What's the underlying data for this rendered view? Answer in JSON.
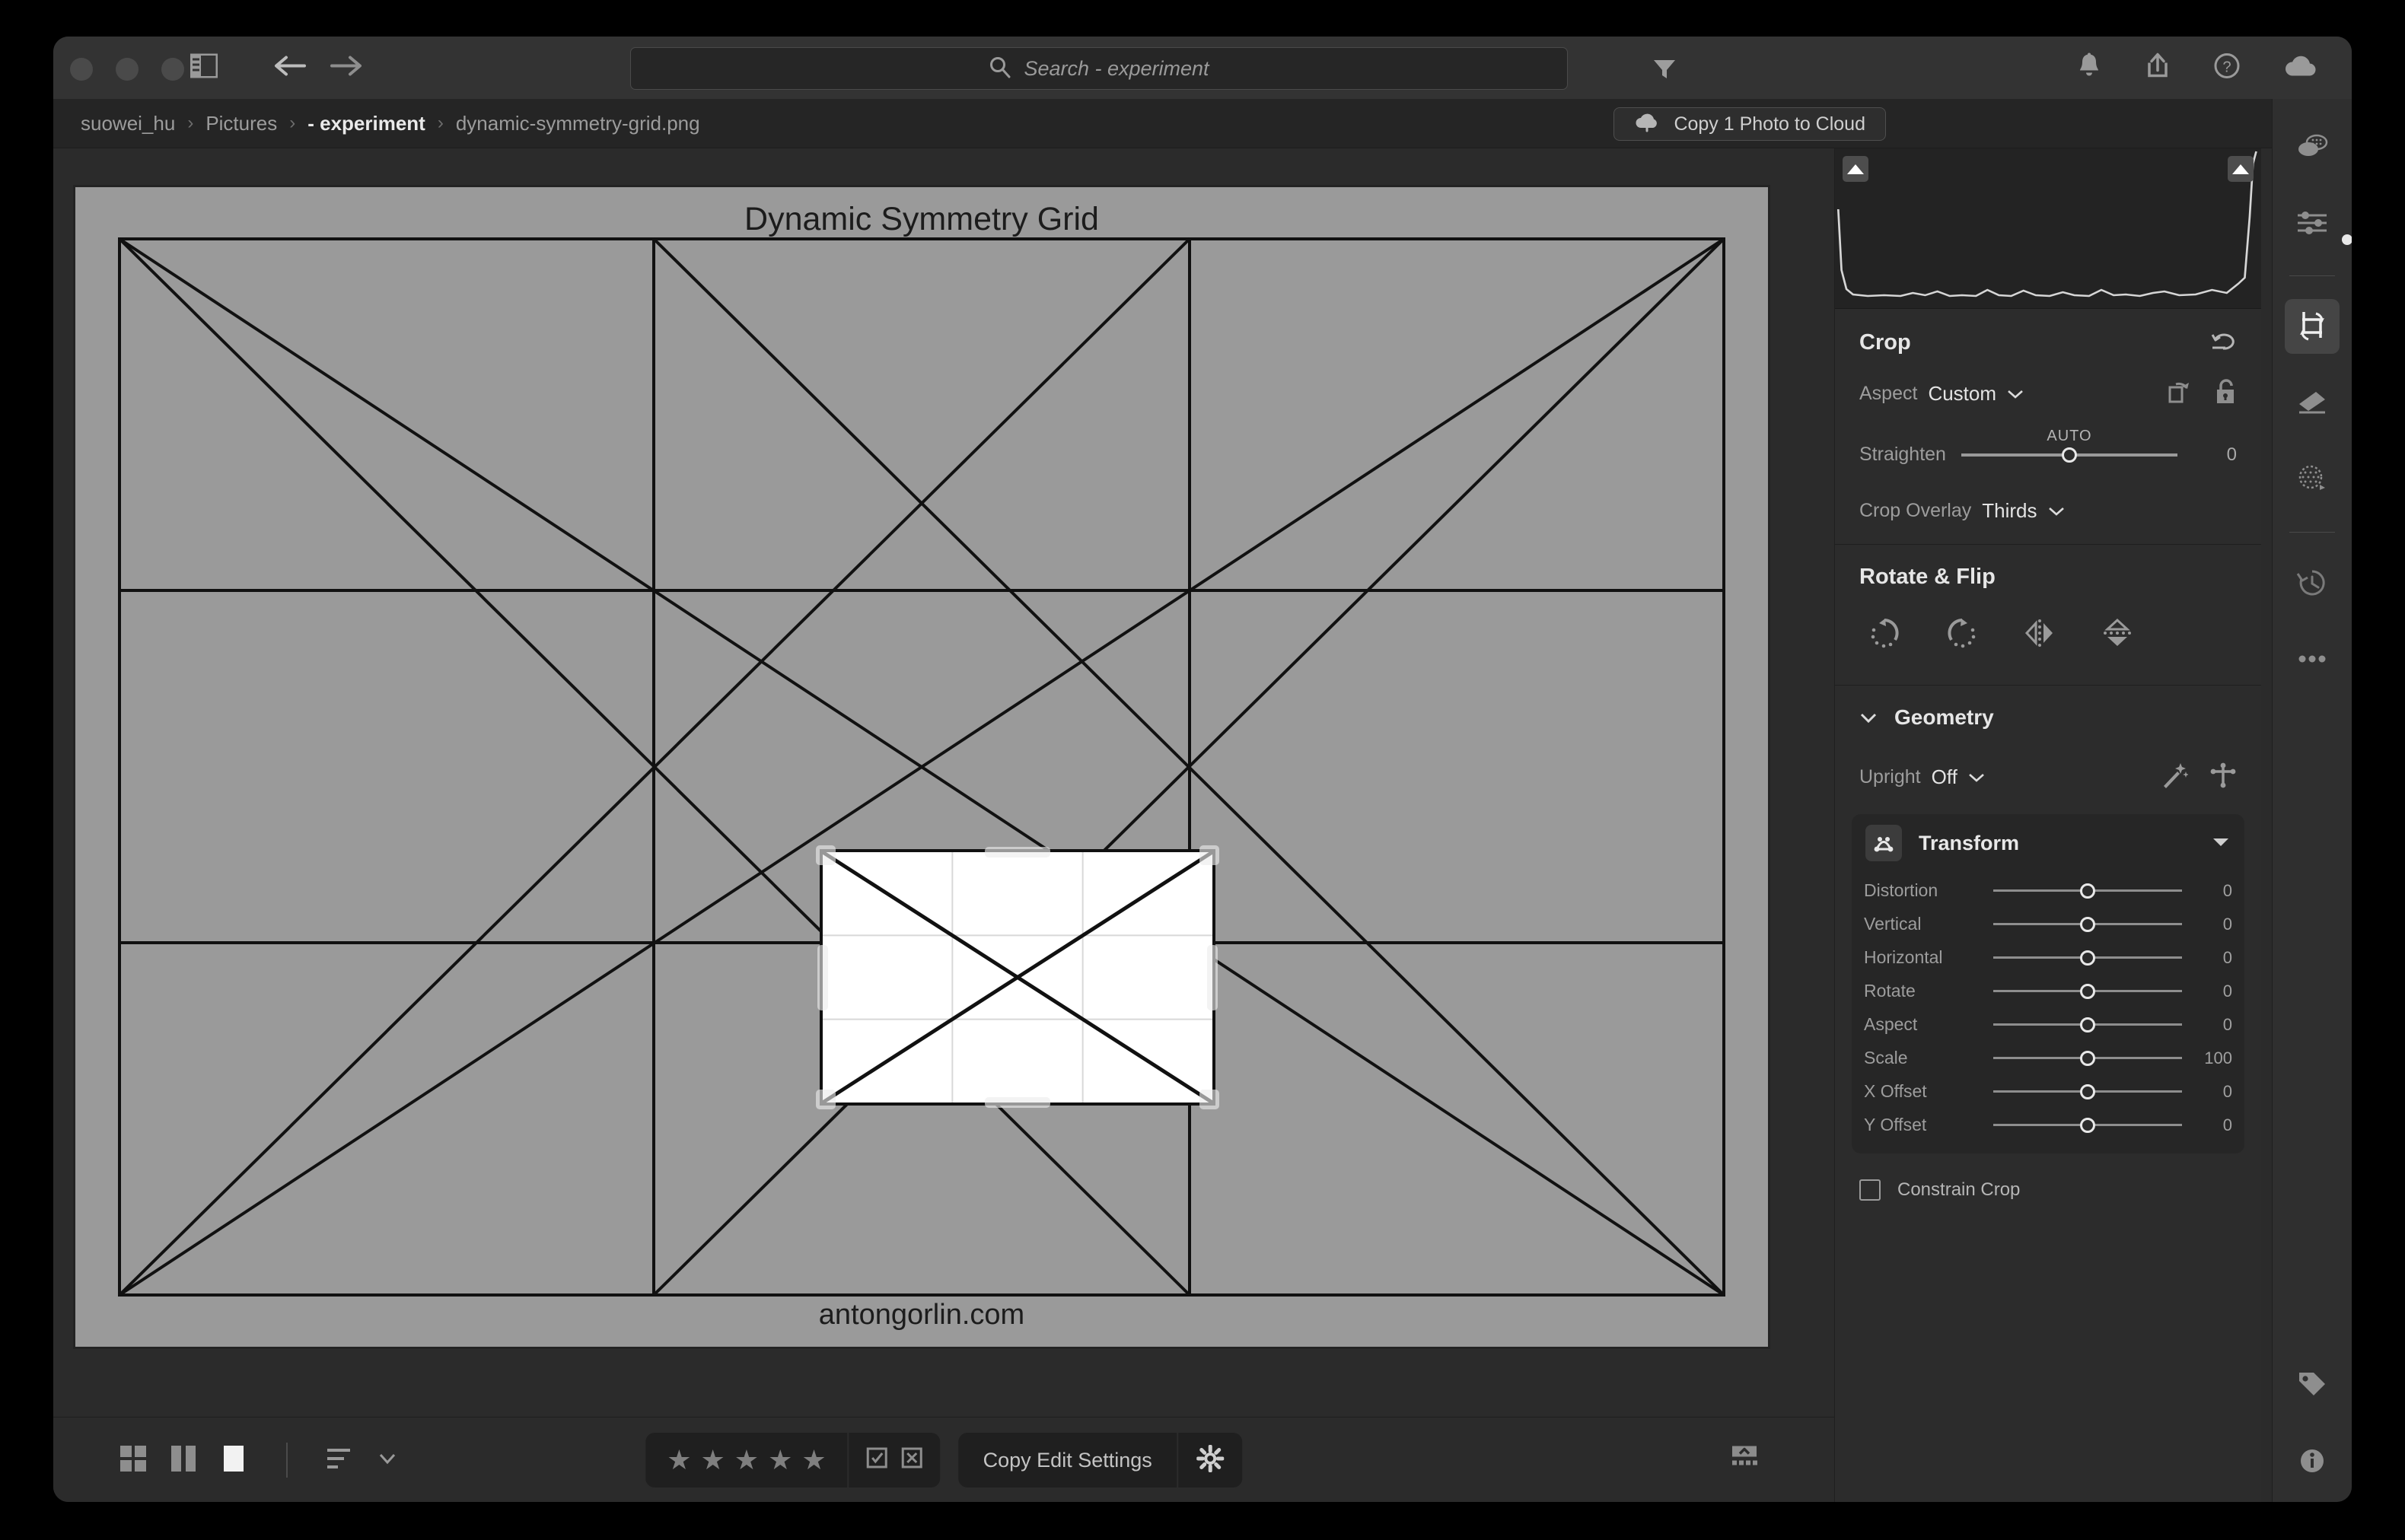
{
  "window": {
    "traffic_lights": [
      "close",
      "minimize",
      "maximize"
    ],
    "panel_toggle_icon": "sidebar-toggle-icon",
    "back_icon": "arrow-left-icon",
    "forward_icon": "arrow-right-icon",
    "notification_icon": "bell-icon",
    "share_icon": "share-icon",
    "help_icon": "help-circle-icon",
    "cloud_icon": "cloud-icon"
  },
  "search": {
    "placeholder": "Search - experiment",
    "icon": "search-icon",
    "filter_icon": "filter-icon"
  },
  "breadcrumb": {
    "items": [
      {
        "label": "suowei_hu",
        "active": false
      },
      {
        "label": "Pictures",
        "active": false
      },
      {
        "label": "- experiment",
        "active": true
      },
      {
        "label": "dynamic-symmetry-grid.png",
        "active": false
      }
    ],
    "separator": "›"
  },
  "cloud_button": {
    "label": "Copy 1 Photo to Cloud",
    "icon": "cloud-upload-icon"
  },
  "photo": {
    "title": "Dynamic Symmetry Grid",
    "footer": "antongorlin.com",
    "background_color": "#9a9a9a",
    "line_color": "#111111",
    "crop_overlay": "Thirds"
  },
  "histogram": {
    "clip_left_icon": "triangle-up-icon",
    "clip_right_icon": "triangle-up-icon"
  },
  "crop": {
    "title": "Crop",
    "reset_icon": "undo-icon",
    "aspect_label": "Aspect",
    "aspect_value": "Custom",
    "rotate_lock_icon": "rotate-aspect-icon",
    "lock_icon": "lock-open-icon",
    "straighten_label": "Straighten",
    "straighten_auto": "AUTO",
    "straighten_value": "0",
    "overlay_label": "Crop Overlay",
    "overlay_value": "Thirds"
  },
  "rotate_flip": {
    "title": "Rotate & Flip",
    "icons": [
      "rotate-clockwise-icon",
      "rotate-counterclockwise-icon",
      "flip-horizontal-icon",
      "flip-vertical-icon"
    ]
  },
  "geometry": {
    "title": "Geometry",
    "chevron_icon": "chevron-down-icon",
    "upright_label": "Upright",
    "upright_value": "Off",
    "auto_icon": "magic-wand-icon",
    "guided_icon": "guided-upright-icon"
  },
  "transform": {
    "title": "Transform",
    "badge_icon": "transform-icon",
    "caret_icon": "caret-down-icon",
    "sliders": [
      {
        "label": "Distortion",
        "value": "0",
        "pos": 50
      },
      {
        "label": "Vertical",
        "value": "0",
        "pos": 50
      },
      {
        "label": "Horizontal",
        "value": "0",
        "pos": 50
      },
      {
        "label": "Rotate",
        "value": "0",
        "pos": 50
      },
      {
        "label": "Aspect",
        "value": "0",
        "pos": 50
      },
      {
        "label": "Scale",
        "value": "100",
        "pos": 50
      },
      {
        "label": "X Offset",
        "value": "0",
        "pos": 50
      },
      {
        "label": "Y Offset",
        "value": "0",
        "pos": 50
      }
    ]
  },
  "constrain": {
    "label": "Constrain Crop",
    "checked": false
  },
  "bottom_bar": {
    "view_grid_icon": "grid-view-icon",
    "view_compare_icon": "compare-view-icon",
    "view_single_icon": "single-view-icon",
    "sort_icon": "sort-icon",
    "sort_chevron_icon": "chevron-down-icon",
    "star_glyph": "★",
    "star_count": 5,
    "flag_pick_icon": "flag-pick-icon",
    "flag_reject_icon": "flag-reject-icon",
    "copy_settings_label": "Copy Edit Settings",
    "gear_icon": "gear-icon",
    "filmstrip_icon": "filmstrip-toggle-icon"
  },
  "rail": {
    "items": [
      {
        "name": "presets-icon",
        "active": false
      },
      {
        "name": "edit-sliders-icon",
        "active": false
      },
      {
        "name": "crop-icon",
        "active": true
      },
      {
        "name": "healing-icon",
        "active": false
      },
      {
        "name": "masking-icon",
        "active": false
      },
      {
        "name": "history-icon",
        "active": false
      },
      {
        "name": "more-icon",
        "active": false
      },
      {
        "name": "tag-icon",
        "active": false
      },
      {
        "name": "info-icon",
        "active": false
      }
    ]
  },
  "chart_data": {
    "type": "line",
    "title": "Histogram",
    "x": [
      0,
      8,
      16,
      24,
      32,
      40,
      48,
      56,
      64,
      72,
      80,
      88,
      96,
      104,
      112,
      120,
      128,
      136,
      144,
      152,
      160,
      168,
      176,
      184,
      192,
      200,
      208,
      216,
      224,
      232,
      240,
      248,
      255
    ],
    "values": [
      62,
      10,
      5,
      4,
      4,
      4,
      5,
      4,
      5,
      8,
      4,
      5,
      9,
      4,
      4,
      4,
      4,
      9,
      4,
      4,
      11,
      4,
      4,
      12,
      4,
      4,
      5,
      10,
      9,
      4,
      5,
      12,
      96
    ],
    "ylim": [
      0,
      100
    ],
    "grid": false,
    "legend": "none"
  }
}
